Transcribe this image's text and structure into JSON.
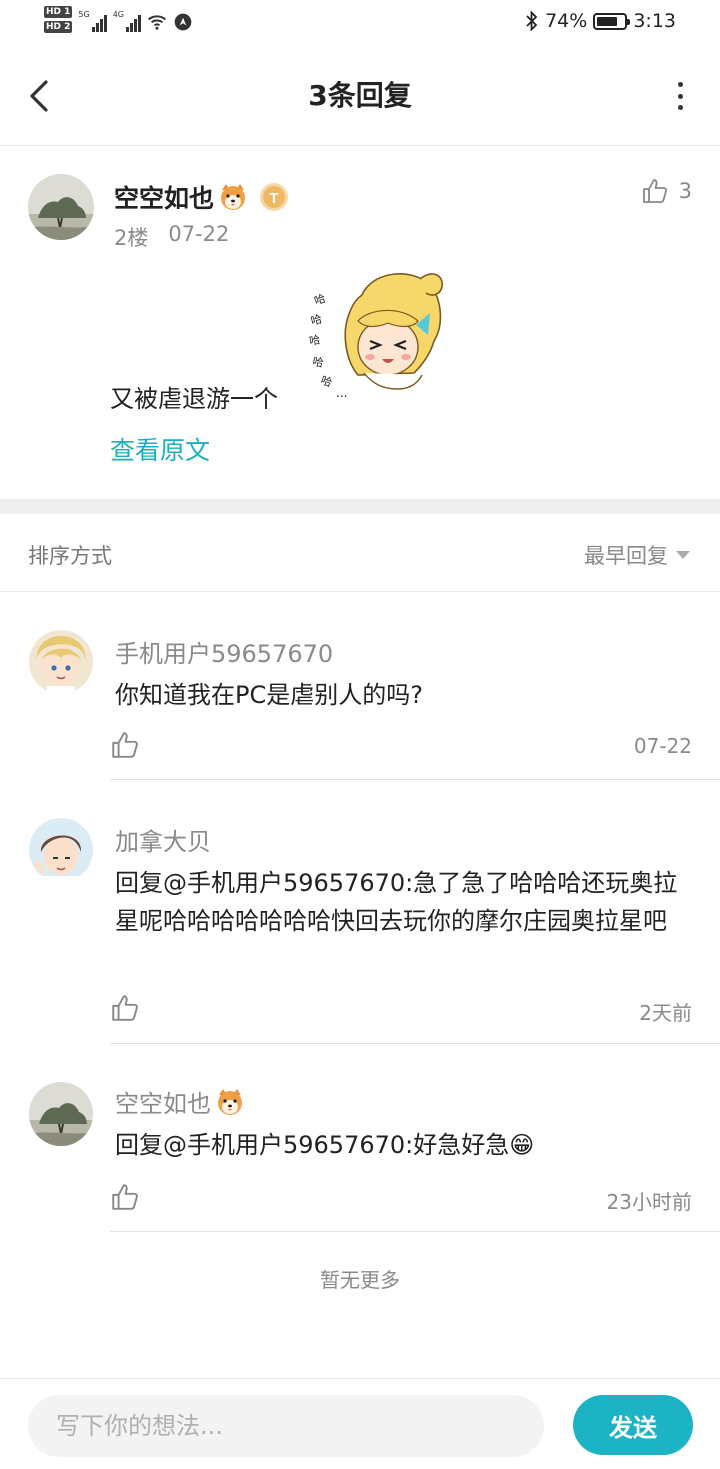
{
  "status_bar": {
    "hd1": "HD 1",
    "hd2": "HD 2",
    "sig1_label": "5G",
    "sig2_label": "4G",
    "battery_percent": "74%",
    "time": "3:13",
    "battery_level": 0.74
  },
  "header": {
    "title": "3条回复"
  },
  "post": {
    "author": "空空如也",
    "floor": "2楼",
    "date": "07-22",
    "likes": "3",
    "text": "又被虐退游一个",
    "view_original": "查看原文"
  },
  "sort": {
    "label": "排序方式",
    "selected": "最早回复"
  },
  "replies": [
    {
      "author": "手机用户59657670",
      "text": "你知道我在PC是虐别人的吗?",
      "time": "07-22"
    },
    {
      "author": "加拿大贝",
      "text": "回复@手机用户59657670:急了急了哈哈哈还玩奥拉星呢哈哈哈哈哈哈哈快回去玩你的摩尔庄园奥拉星吧",
      "time": "2天前"
    },
    {
      "author": "空空如也",
      "text": "回复@手机用户59657670:好急好急😁",
      "time": "23小时前"
    }
  ],
  "footer": {
    "no_more": "暂无更多"
  },
  "composer": {
    "placeholder": "写下你的想法...",
    "send_label": "发送"
  },
  "colors": {
    "accent": "#1cb3c4",
    "link": "#1ab0c0"
  }
}
